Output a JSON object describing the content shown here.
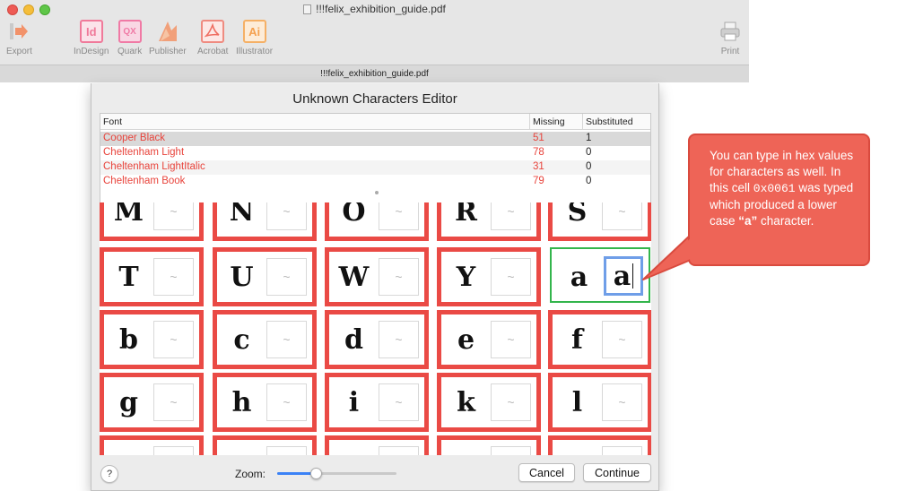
{
  "window": {
    "title": "!!!felix_exhibition_guide.pdf",
    "path_title": "!!!felix_exhibition_guide.pdf"
  },
  "toolbar": {
    "export": {
      "label": "Export"
    },
    "indesign": {
      "label": "InDesign",
      "glyph": "Id"
    },
    "quark": {
      "label": "Quark",
      "glyph": "QX"
    },
    "publisher": {
      "label": "Publisher"
    },
    "acrobat": {
      "label": "Acrobat"
    },
    "illustrator": {
      "label": "Illustrator",
      "glyph": "Ai"
    },
    "print": {
      "label": "Print"
    }
  },
  "dialog": {
    "title": "Unknown Characters Editor",
    "columns": {
      "font": "Font",
      "missing": "Missing",
      "substituted": "Substituted"
    },
    "fonts": [
      {
        "name": "Cooper Black",
        "missing": "51",
        "substituted": "1"
      },
      {
        "name": "Cheltenham Light",
        "missing": "78",
        "substituted": "0"
      },
      {
        "name": "Cheltenham LightItalic",
        "missing": "31",
        "substituted": "0"
      },
      {
        "name": "Cheltenham Book",
        "missing": "79",
        "substituted": "0"
      }
    ],
    "glyph_rows": [
      [
        "M",
        "N",
        "O",
        "R",
        "S"
      ],
      [
        "T",
        "U",
        "W",
        "Y",
        "a"
      ],
      [
        "b",
        "c",
        "d",
        "e",
        "f"
      ],
      [
        "g",
        "h",
        "i",
        "k",
        "l"
      ],
      [
        "",
        "",
        "",
        "",
        ""
      ]
    ],
    "placeholder_symbol": "~",
    "active_substitution": "a",
    "zoom_label": "Zoom:",
    "zoom_level": 0.32,
    "help_label": "?",
    "cancel_label": "Cancel",
    "continue_label": "Continue"
  },
  "callout": {
    "part1": "You can type in hex values for characters as well. In this cell ",
    "code": "0x0061",
    "part2": " was typed which produced a lower case ",
    "quoted": "“a”",
    "part3": " character."
  },
  "colors": {
    "missing_red": "#e8433b",
    "cell_border": "#ea4a45",
    "active_cell_border": "#33b54c",
    "callout_fill": "#ee6457",
    "zoom_accent": "#3b82f6"
  }
}
